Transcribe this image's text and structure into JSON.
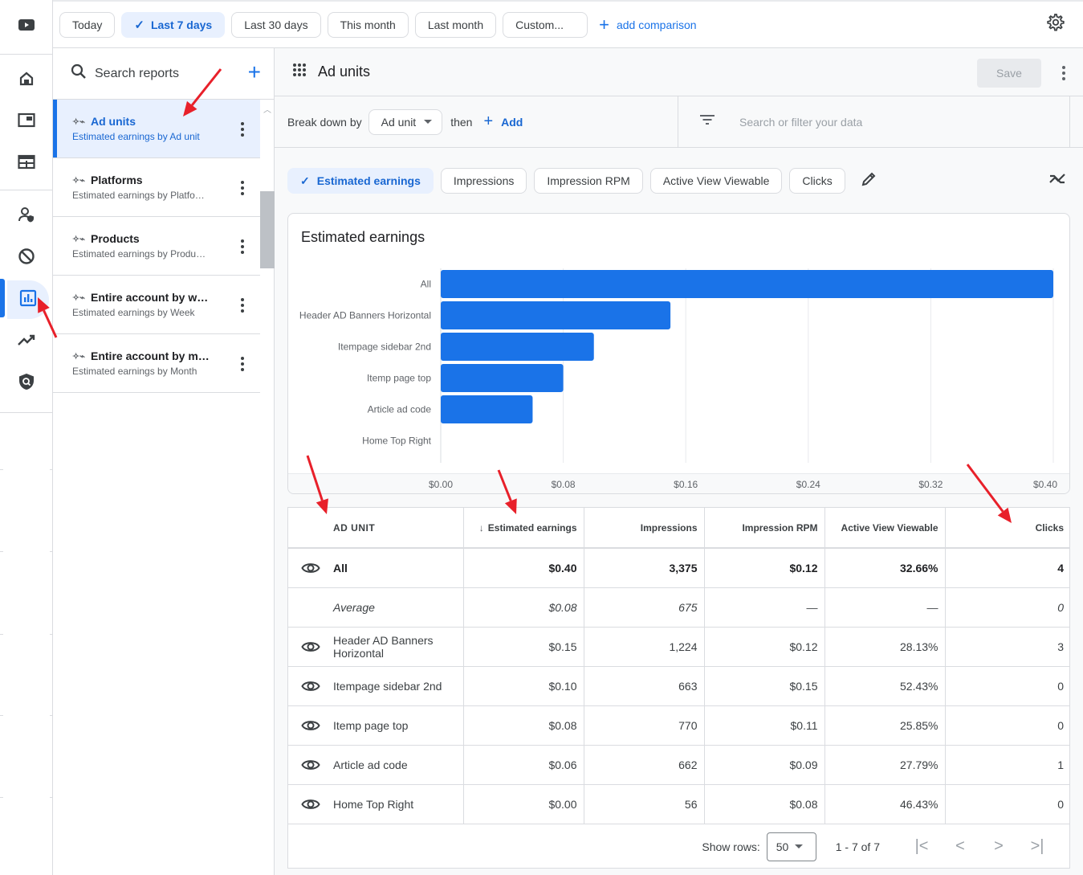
{
  "date_range": {
    "chips": [
      {
        "label": "Today",
        "selected": false
      },
      {
        "label": "Last 7 days",
        "selected": true
      },
      {
        "label": "Last 30 days",
        "selected": false
      },
      {
        "label": "This month",
        "selected": false
      },
      {
        "label": "Last month",
        "selected": false
      },
      {
        "label": "Custom...",
        "selected": false
      }
    ],
    "add_comparison_label": "add comparison"
  },
  "rail": {
    "items": [
      "youtube-icon",
      "home-icon",
      "sites-icon",
      "ads-icon",
      "account-access-icon",
      "blocking-icon",
      "reports-icon",
      "optimization-icon",
      "privacy-icon"
    ],
    "active": "reports-icon"
  },
  "reports_panel": {
    "search_placeholder": "Search reports",
    "items": [
      {
        "title": "Ad units",
        "subtitle": "Estimated earnings by Ad unit",
        "active": true
      },
      {
        "title": "Platforms",
        "subtitle": "Estimated earnings by Platfo…",
        "active": false
      },
      {
        "title": "Products",
        "subtitle": "Estimated earnings by Produ…",
        "active": false
      },
      {
        "title": "Entire account by w…",
        "subtitle": "Estimated earnings by Week",
        "active": false
      },
      {
        "title": "Entire account by m…",
        "subtitle": "Estimated earnings by Month",
        "active": false
      }
    ]
  },
  "report": {
    "title": "Ad units",
    "save_label": "Save",
    "breakdown_label": "Break down by",
    "breakdown_value": "Ad unit",
    "then_label": "then",
    "add_label": "Add",
    "filter_placeholder": "Search or filter your data",
    "metrics": [
      {
        "label": "Estimated earnings",
        "selected": true
      },
      {
        "label": "Impressions",
        "selected": false
      },
      {
        "label": "Impression RPM",
        "selected": false
      },
      {
        "label": "Active View Viewable",
        "selected": false
      },
      {
        "label": "Clicks",
        "selected": false
      }
    ]
  },
  "chart_data": {
    "type": "bar",
    "orientation": "horizontal",
    "title": "Estimated earnings",
    "categories": [
      "All",
      "Header AD Banners Horizontal",
      "Itempage sidebar 2nd",
      "Itemp page top",
      "Article ad code",
      "Home Top Right"
    ],
    "values": [
      0.4,
      0.15,
      0.1,
      0.08,
      0.06,
      0.0
    ],
    "xlim": [
      0,
      0.4
    ],
    "x_ticks": [
      "$0.00",
      "$0.08",
      "$0.16",
      "$0.24",
      "$0.32",
      "$0.40"
    ],
    "x_tick_values": [
      0,
      0.08,
      0.16,
      0.24,
      0.32,
      0.4
    ],
    "xlabel": "",
    "ylabel": "",
    "grid": true,
    "bar_color": "#1a73e8"
  },
  "table": {
    "columns": [
      "AD UNIT",
      "Estimated earnings",
      "Impressions",
      "Impression RPM",
      "Active View Viewable",
      "Clicks"
    ],
    "sorted_column": "Estimated earnings",
    "total": {
      "name": "All",
      "values": [
        "$0.40",
        "3,375",
        "$0.12",
        "32.66%",
        "4"
      ]
    },
    "average": {
      "name": "Average",
      "values": [
        "$0.08",
        "675",
        "—",
        "—",
        "0"
      ]
    },
    "rows": [
      {
        "name": "Header AD Banners Horizontal",
        "values": [
          "$0.15",
          "1,224",
          "$0.12",
          "28.13%",
          "3"
        ]
      },
      {
        "name": "Itempage sidebar 2nd",
        "values": [
          "$0.10",
          "663",
          "$0.15",
          "52.43%",
          "0"
        ]
      },
      {
        "name": "Itemp page top",
        "values": [
          "$0.08",
          "770",
          "$0.11",
          "25.85%",
          "0"
        ]
      },
      {
        "name": "Article ad code",
        "values": [
          "$0.06",
          "662",
          "$0.09",
          "27.79%",
          "1"
        ]
      },
      {
        "name": "Home Top Right",
        "values": [
          "$0.00",
          "56",
          "$0.08",
          "46.43%",
          "0"
        ]
      }
    ],
    "show_rows_label": "Show rows:",
    "rows_per_page": "50",
    "range_label": "1 - 7 of 7"
  },
  "colors": {
    "accent": "#1a73e8",
    "selected_bg": "#e8f0fe",
    "annotation_arrow": "#e8202a"
  }
}
